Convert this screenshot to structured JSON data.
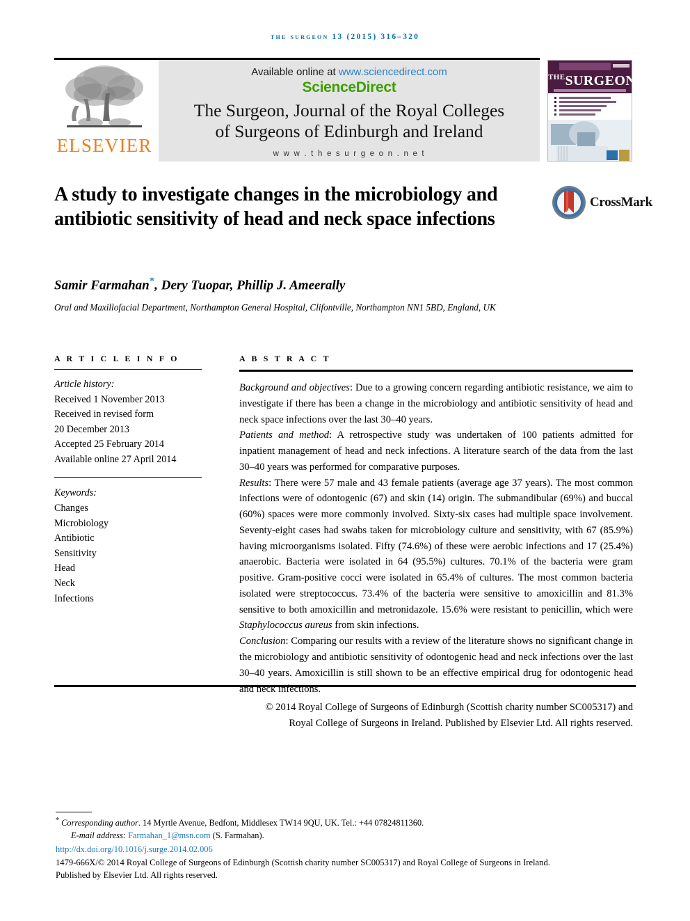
{
  "running_head": "The Surgeon 13 (2015) 316–320",
  "masthead": {
    "publisher_name": "ELSEVIER",
    "publisher_logo_icon": "elsevier-tree-icon",
    "available_prefix": "Available online at ",
    "available_url": "www.sciencedirect.com",
    "sciencedirect_logo": "ScienceDirect",
    "journal_title_line1": "The Surgeon, Journal of the Royal Colleges",
    "journal_title_line2": "of Surgeons of Edinburgh and Ireland",
    "journal_url": "w w w . t h e s u r g e o n . n e t",
    "cover": {
      "title": "SURGEON",
      "title_prefix": "THE",
      "alt": "journal-cover-thumbnail"
    }
  },
  "article": {
    "title": "A study to investigate changes in the microbiology and antibiotic sensitivity of head and neck space infections",
    "authors": "Samir Farmahan",
    "authors_rest": ", Dery Tuopar, Phillip J. Ameerally",
    "corresponding_marker": "*",
    "affiliation": "Oral and Maxillofacial Department, Northampton General Hospital, Clifontville, Northampton NN1 5BD, England, UK",
    "crossmark_label": "CrossMark",
    "crossmark_icon": "crossmark-badge-icon"
  },
  "article_info": {
    "heading": "A R T I C L E   I N F O",
    "history_label": "Article history:",
    "history": [
      "Received 1 November 2013",
      "Received in revised form",
      "20 December 2013",
      "Accepted 25 February 2014",
      "Available online 27 April 2014"
    ],
    "keywords_label": "Keywords:",
    "keywords": [
      "Changes",
      "Microbiology",
      "Antibiotic",
      "Sensitivity",
      "Head",
      "Neck",
      "Infections"
    ]
  },
  "abstract": {
    "heading": "A B S T R A C T",
    "sections": [
      {
        "lead": "Background and objectives",
        "text": ": Due to a growing concern regarding antibiotic resistance, we aim to investigate if there has been a change in the microbiology and antibiotic sensitivity of head and neck space infections over the last 30–40 years."
      },
      {
        "lead": "Patients and method",
        "text": ": A retrospective study was undertaken of 100 patients admitted for inpatient management of head and neck infections. A literature search of the data from the last 30–40 years was performed for comparative purposes."
      },
      {
        "lead": "Results",
        "text": ": There were 57 male and 43 female patients (average age 37 years). The most common infections were of odontogenic (67) and skin (14) origin. The submandibular (69%) and buccal (60%) spaces were more commonly involved. Sixty-six cases had multiple space involvement. Seventy-eight cases had swabs taken for microbiology culture and sensitivity, with 67 (85.9%) having microorganisms isolated. Fifty (74.6%) of these were aerobic infections and 17 (25.4%) anaerobic. Bacteria were isolated in 64 (95.5%) cultures. 70.1% of the bacteria were gram positive. Gram-positive cocci were isolated in 65.4% of cultures. The most common bacteria isolated were streptococcus. 73.4% of the bacteria were sensitive to amoxicillin and 81.3% sensitive to both amoxicillin and metronidazole. 15.6% were resistant to penicillin, which were ",
        "italic_tail": "Staphylococcus aureus",
        "text_after": " from skin infections."
      },
      {
        "lead": "Conclusion",
        "text": ": Comparing our results with a review of the literature shows no significant change in the microbiology and antibiotic sensitivity of odontogenic head and neck infections over the last 30–40 years. Amoxicillin is still shown to be an effective empirical drug for odontogenic head and neck infections."
      }
    ],
    "copyright_line1": "© 2014 Royal College of Surgeons of Edinburgh (Scottish charity number SC005317) and",
    "copyright_line2": "Royal College of Surgeons in Ireland. Published by Elsevier Ltd. All rights reserved."
  },
  "footnotes": {
    "corresponding_marker": "*",
    "corresponding_label": "Corresponding author",
    "corresponding_text": ". 14 Myrtle Avenue, Bedfont, Middlesex TW14 9QU, UK. Tel.: +44 07824811360.",
    "email_label": "E-mail address:",
    "email_link": "Farmahan_1@msn.com",
    "email_suffix": "(S. Farmahan).",
    "doi": "http://dx.doi.org/10.1016/j.surge.2014.02.006",
    "imprint_line1": "1479-666X/© 2014 Royal College of Surgeons of Edinburgh (Scottish charity number SC005317) and Royal College of Surgeons in Ireland.",
    "imprint_line2": "Published by Elsevier Ltd. All rights reserved."
  },
  "colors": {
    "running_head": "#0b6ea8",
    "sciencedirect_green": "#3ca000",
    "elsevier_orange": "#ef7d1a",
    "link_blue": "#1f7bb6",
    "cover_purple": "#4b1b40"
  }
}
